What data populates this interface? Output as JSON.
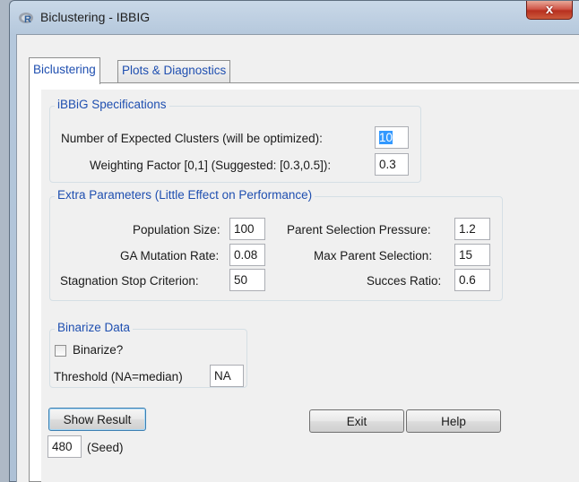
{
  "window": {
    "title": "Biclustering - IBBIG",
    "close_glyph": "x",
    "icon": "r-logo-icon"
  },
  "tabs": [
    {
      "label": "Biclustering",
      "active": true
    },
    {
      "label": "Plots & Diagnostics",
      "active": false
    }
  ],
  "ibbig_specs": {
    "legend": "iBBiG Specifications",
    "num_clusters": {
      "label": "Number of Expected Clusters (will be optimized):",
      "value": "10"
    },
    "weighting": {
      "label": "Weighting Factor [0,1] (Suggested: [0.3,0.5]):",
      "value": "0.3"
    }
  },
  "extra_params": {
    "legend": "Extra Parameters (Little Effect on Performance)",
    "population_size": {
      "label": "Population Size:",
      "value": "100"
    },
    "ga_mutation_rate": {
      "label": "GA Mutation Rate:",
      "value": "0.08"
    },
    "stagnation_stop": {
      "label": "Stagnation Stop Criterion:",
      "value": "50"
    },
    "parent_selection_pressure": {
      "label": "Parent Selection Pressure:",
      "value": "1.2"
    },
    "max_parent_selection": {
      "label": "Max Parent Selection:",
      "value": "15"
    },
    "succes_ratio": {
      "label": "Succes Ratio:",
      "value": "0.6"
    }
  },
  "binarize": {
    "legend": "Binarize Data",
    "checkbox_label": "Binarize?",
    "checked": false,
    "threshold": {
      "label": "Threshold (NA=median)",
      "value": "NA"
    }
  },
  "buttons": {
    "show_result": "Show Result",
    "exit": "Exit",
    "help": "Help"
  },
  "seed": {
    "value": "480",
    "label": "(Seed)"
  },
  "colors": {
    "accent_text": "#1f4fb0",
    "selection": "#3399ff",
    "close_button": "#c8442f"
  }
}
